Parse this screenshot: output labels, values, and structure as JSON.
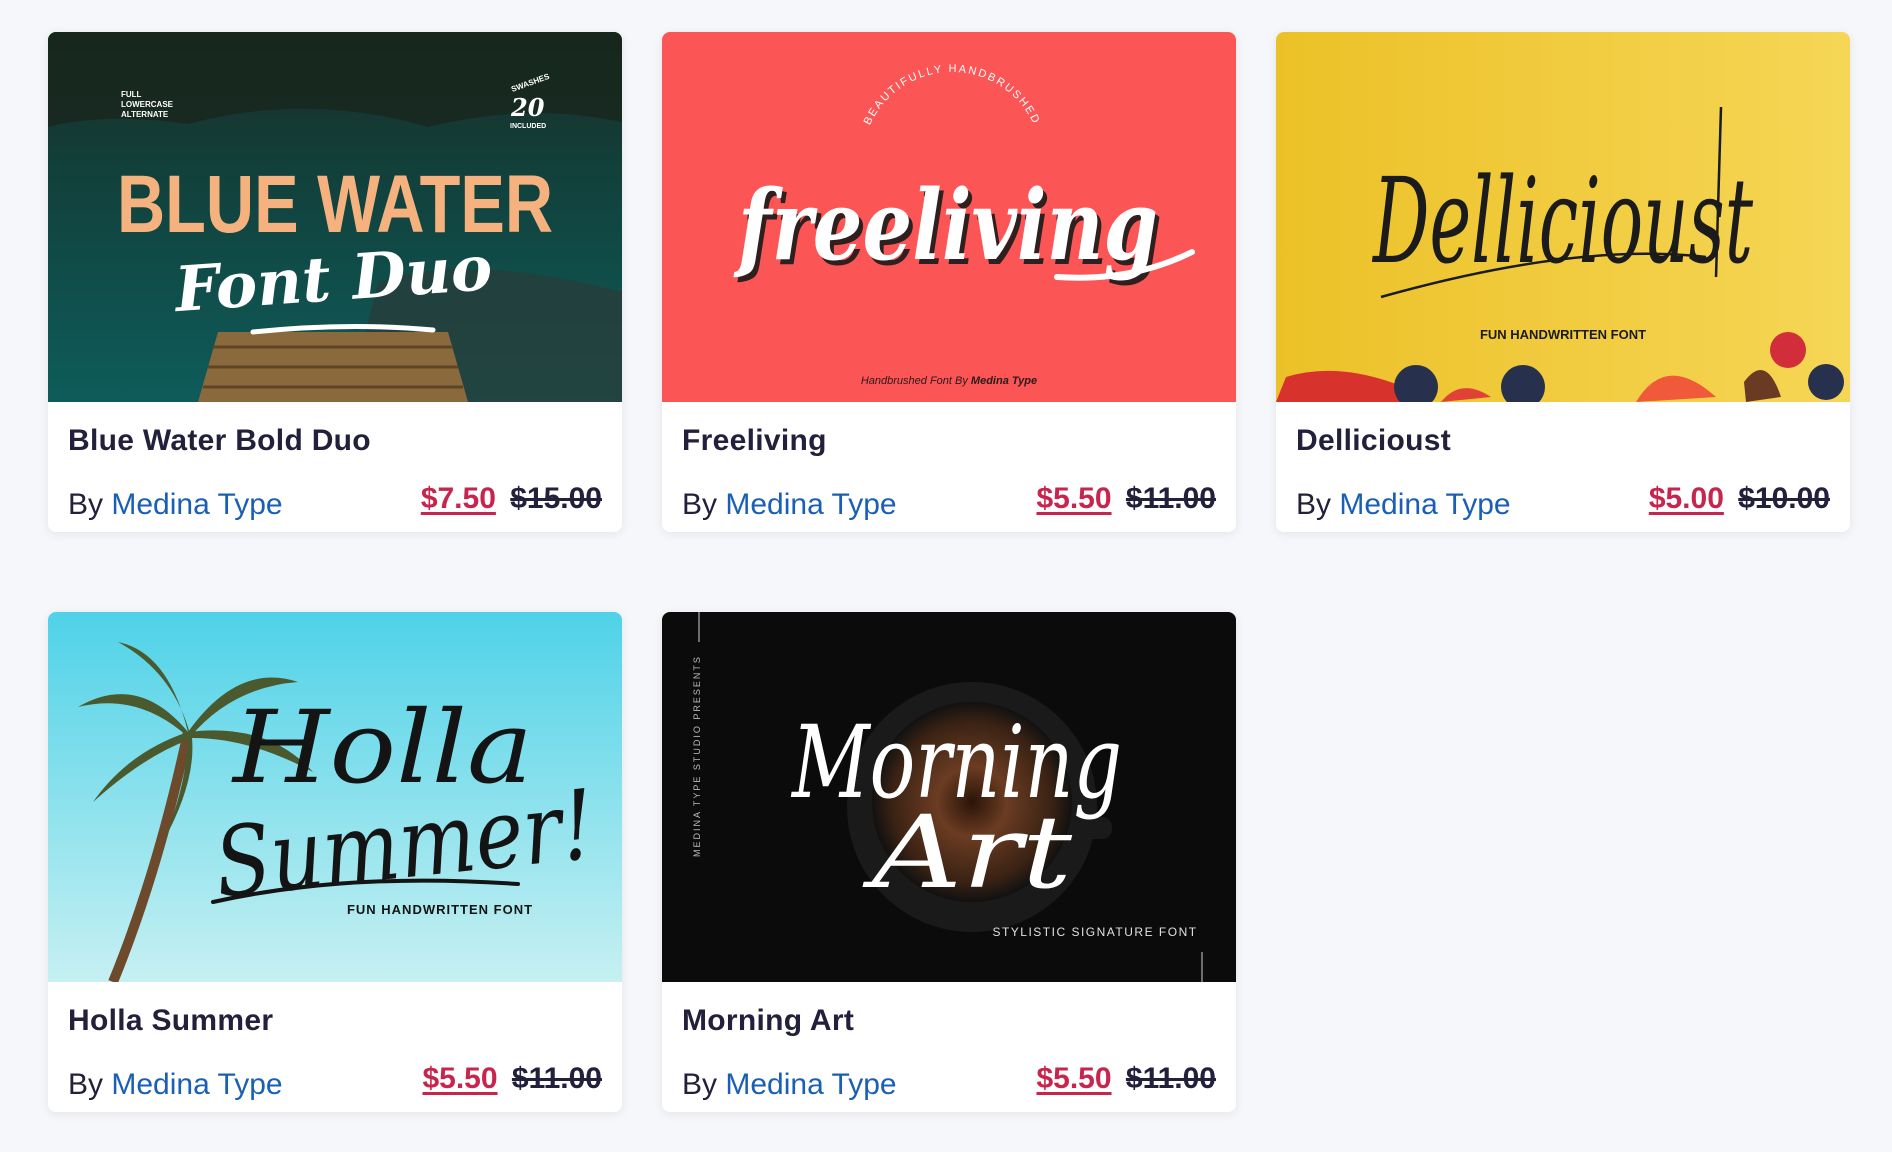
{
  "products": [
    {
      "title": "Blue Water Bold Duo",
      "by_label": "By",
      "author": "Medina Type",
      "sale_price": "$7.50",
      "original_price": "$15.00",
      "thumbnail": {
        "headline": "BLUE WATER",
        "script": "Font Duo",
        "corner_left": [
          "FULL",
          "LOWERCASE",
          "ALTERNATE"
        ],
        "corner_right_top": "SWASHES",
        "corner_right_num": "20",
        "corner_right_bottom": "INCLUDED",
        "colors": {
          "water": "#0e5c5a",
          "headline": "#f6b27e"
        }
      }
    },
    {
      "title": "Freeliving",
      "by_label": "By",
      "author": "Medina Type",
      "sale_price": "$5.50",
      "original_price": "$11.00",
      "thumbnail": {
        "script": "freeliving",
        "arc_text": "BEAUTIFULLY HANDBRUSHED",
        "footer_prefix": "Handbrushed Font By ",
        "footer_brand": "Medina Type",
        "colors": {
          "background": "#fb5556"
        }
      }
    },
    {
      "title": "Dellicioust",
      "by_label": "By",
      "author": "Medina Type",
      "sale_price": "$5.00",
      "original_price": "$10.00",
      "thumbnail": {
        "script": "Dellicioust",
        "subtitle": "FUN HANDWRITTEN FONT",
        "colors": {
          "background": "#f1c52e"
        }
      }
    },
    {
      "title": "Holla Summer",
      "by_label": "By",
      "author": "Medina Type",
      "sale_price": "$5.50",
      "original_price": "$11.00",
      "thumbnail": {
        "script_line1": "Holla",
        "script_line2": "Summer!",
        "subtitle": "FUN HANDWRITTEN FONT",
        "colors": {
          "sky_top": "#4fd2e8",
          "sky_bottom": "#c6f0f2"
        }
      }
    },
    {
      "title": "Morning Art",
      "by_label": "By",
      "author": "Medina Type",
      "sale_price": "$5.50",
      "original_price": "$11.00",
      "thumbnail": {
        "script_line1": "Morning",
        "script_line2": "Art",
        "side_text": "MEDINA TYPE STUDIO PRESENTS",
        "subtitle": "STYLISTIC SIGNATURE FONT",
        "colors": {
          "background": "#0b0b0b",
          "coffee": "#6b3c22"
        }
      }
    }
  ],
  "colors": {
    "page_background": "#f6f7fa",
    "title_text": "#22203a",
    "author_link": "#1a5fb4",
    "sale_price": "#c7254e"
  }
}
